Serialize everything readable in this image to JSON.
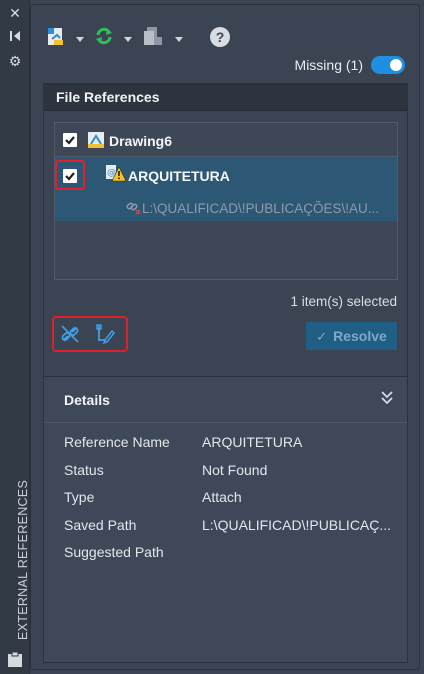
{
  "palette": {
    "title": "EXTERNAL REFERENCES",
    "strip_icons": [
      "close-icon",
      "collapse-icon",
      "settings-icon"
    ]
  },
  "toolbar": {
    "help_label": "?",
    "missing_label": "Missing (1)",
    "missing_toggle_on": true
  },
  "file_references": {
    "header": "File References",
    "items": [
      {
        "name": "Drawing6",
        "checked": true,
        "icon": "drawing-icon"
      },
      {
        "name": "ARQUITETURA",
        "checked": true,
        "icon": "xref-warning-icon",
        "path": "L:\\QUALIFICAD\\!PUBLICAÇÕES\\!AU..."
      }
    ],
    "selected_count": "1 item(s) selected",
    "resolve_label": "Resolve"
  },
  "details": {
    "header": "Details",
    "rows": [
      {
        "label": "Reference Name",
        "value": "ARQUITETURA"
      },
      {
        "label": "Status",
        "value": "Not Found"
      },
      {
        "label": "Type",
        "value": "Attach"
      },
      {
        "label": "Saved Path",
        "value": "L:\\QUALIFICAD\\!PUBLICAÇ..."
      },
      {
        "label": "Suggested Path",
        "value": ""
      }
    ]
  },
  "colors": {
    "accent": "#1e90e0",
    "highlight_row": "#2c5775",
    "annotation_red": "#e0202a",
    "warning": "#f2c230"
  }
}
